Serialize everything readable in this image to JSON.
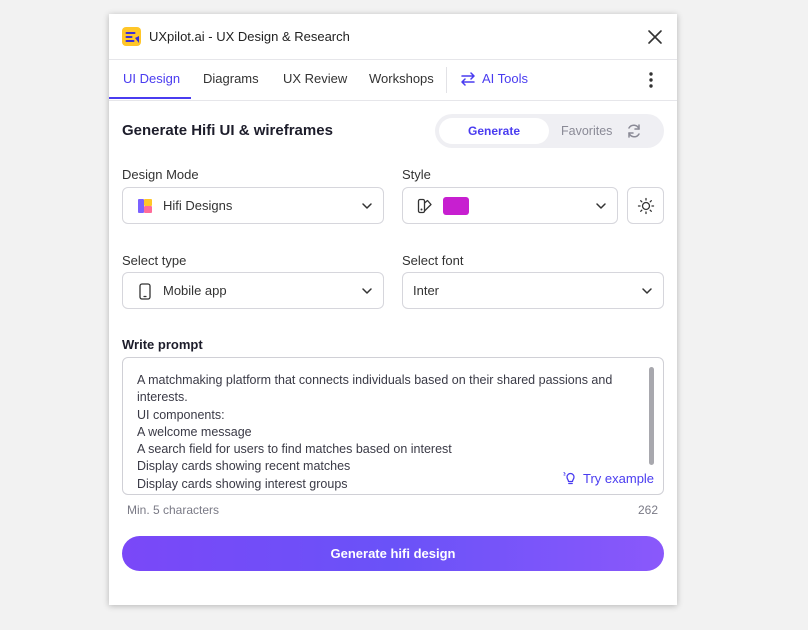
{
  "window": {
    "title": "UXpilot.ai - UX Design & Research"
  },
  "tabs": [
    {
      "label": "UI Design",
      "active": true
    },
    {
      "label": "Diagrams"
    },
    {
      "label": "UX Review"
    },
    {
      "label": "Workshops"
    }
  ],
  "ai_tools": {
    "label": "AI Tools"
  },
  "header": {
    "title": "Generate Hifi UI & wireframes"
  },
  "segment": {
    "generate": "Generate",
    "favorites": "Favorites"
  },
  "design_mode": {
    "label": "Design Mode",
    "value": "Hifi Designs"
  },
  "style": {
    "label": "Style",
    "swatch_color": "#c71fd0"
  },
  "select_type": {
    "label": "Select type",
    "value": "Mobile app"
  },
  "select_font": {
    "label": "Select font",
    "value": "Inter"
  },
  "prompt": {
    "label": "Write prompt",
    "value": "A matchmaking platform that connects individuals based on their shared passions and interests.\nUI components:\nA welcome message\nA search field for users to find matches based on interest\nDisplay cards showing recent matches\nDisplay cards showing interest groups",
    "try_example": "Try example",
    "hint": "Min. 5 characters",
    "count": "262"
  },
  "actions": {
    "generate_label": "Generate hifi design"
  },
  "colors": {
    "accent": "#4a3cf0",
    "button_gradient_start": "#7a48f8",
    "button_gradient_end": "#8a58fb"
  },
  "icons": [
    "app-logo-icon",
    "close-icon",
    "swap-arrows-icon",
    "more-vertical-icon",
    "refresh-icon",
    "layers-icon",
    "palette-icon",
    "sun-icon",
    "smartphone-icon",
    "chevron-down-icon",
    "sparkle-bulb-icon"
  ]
}
